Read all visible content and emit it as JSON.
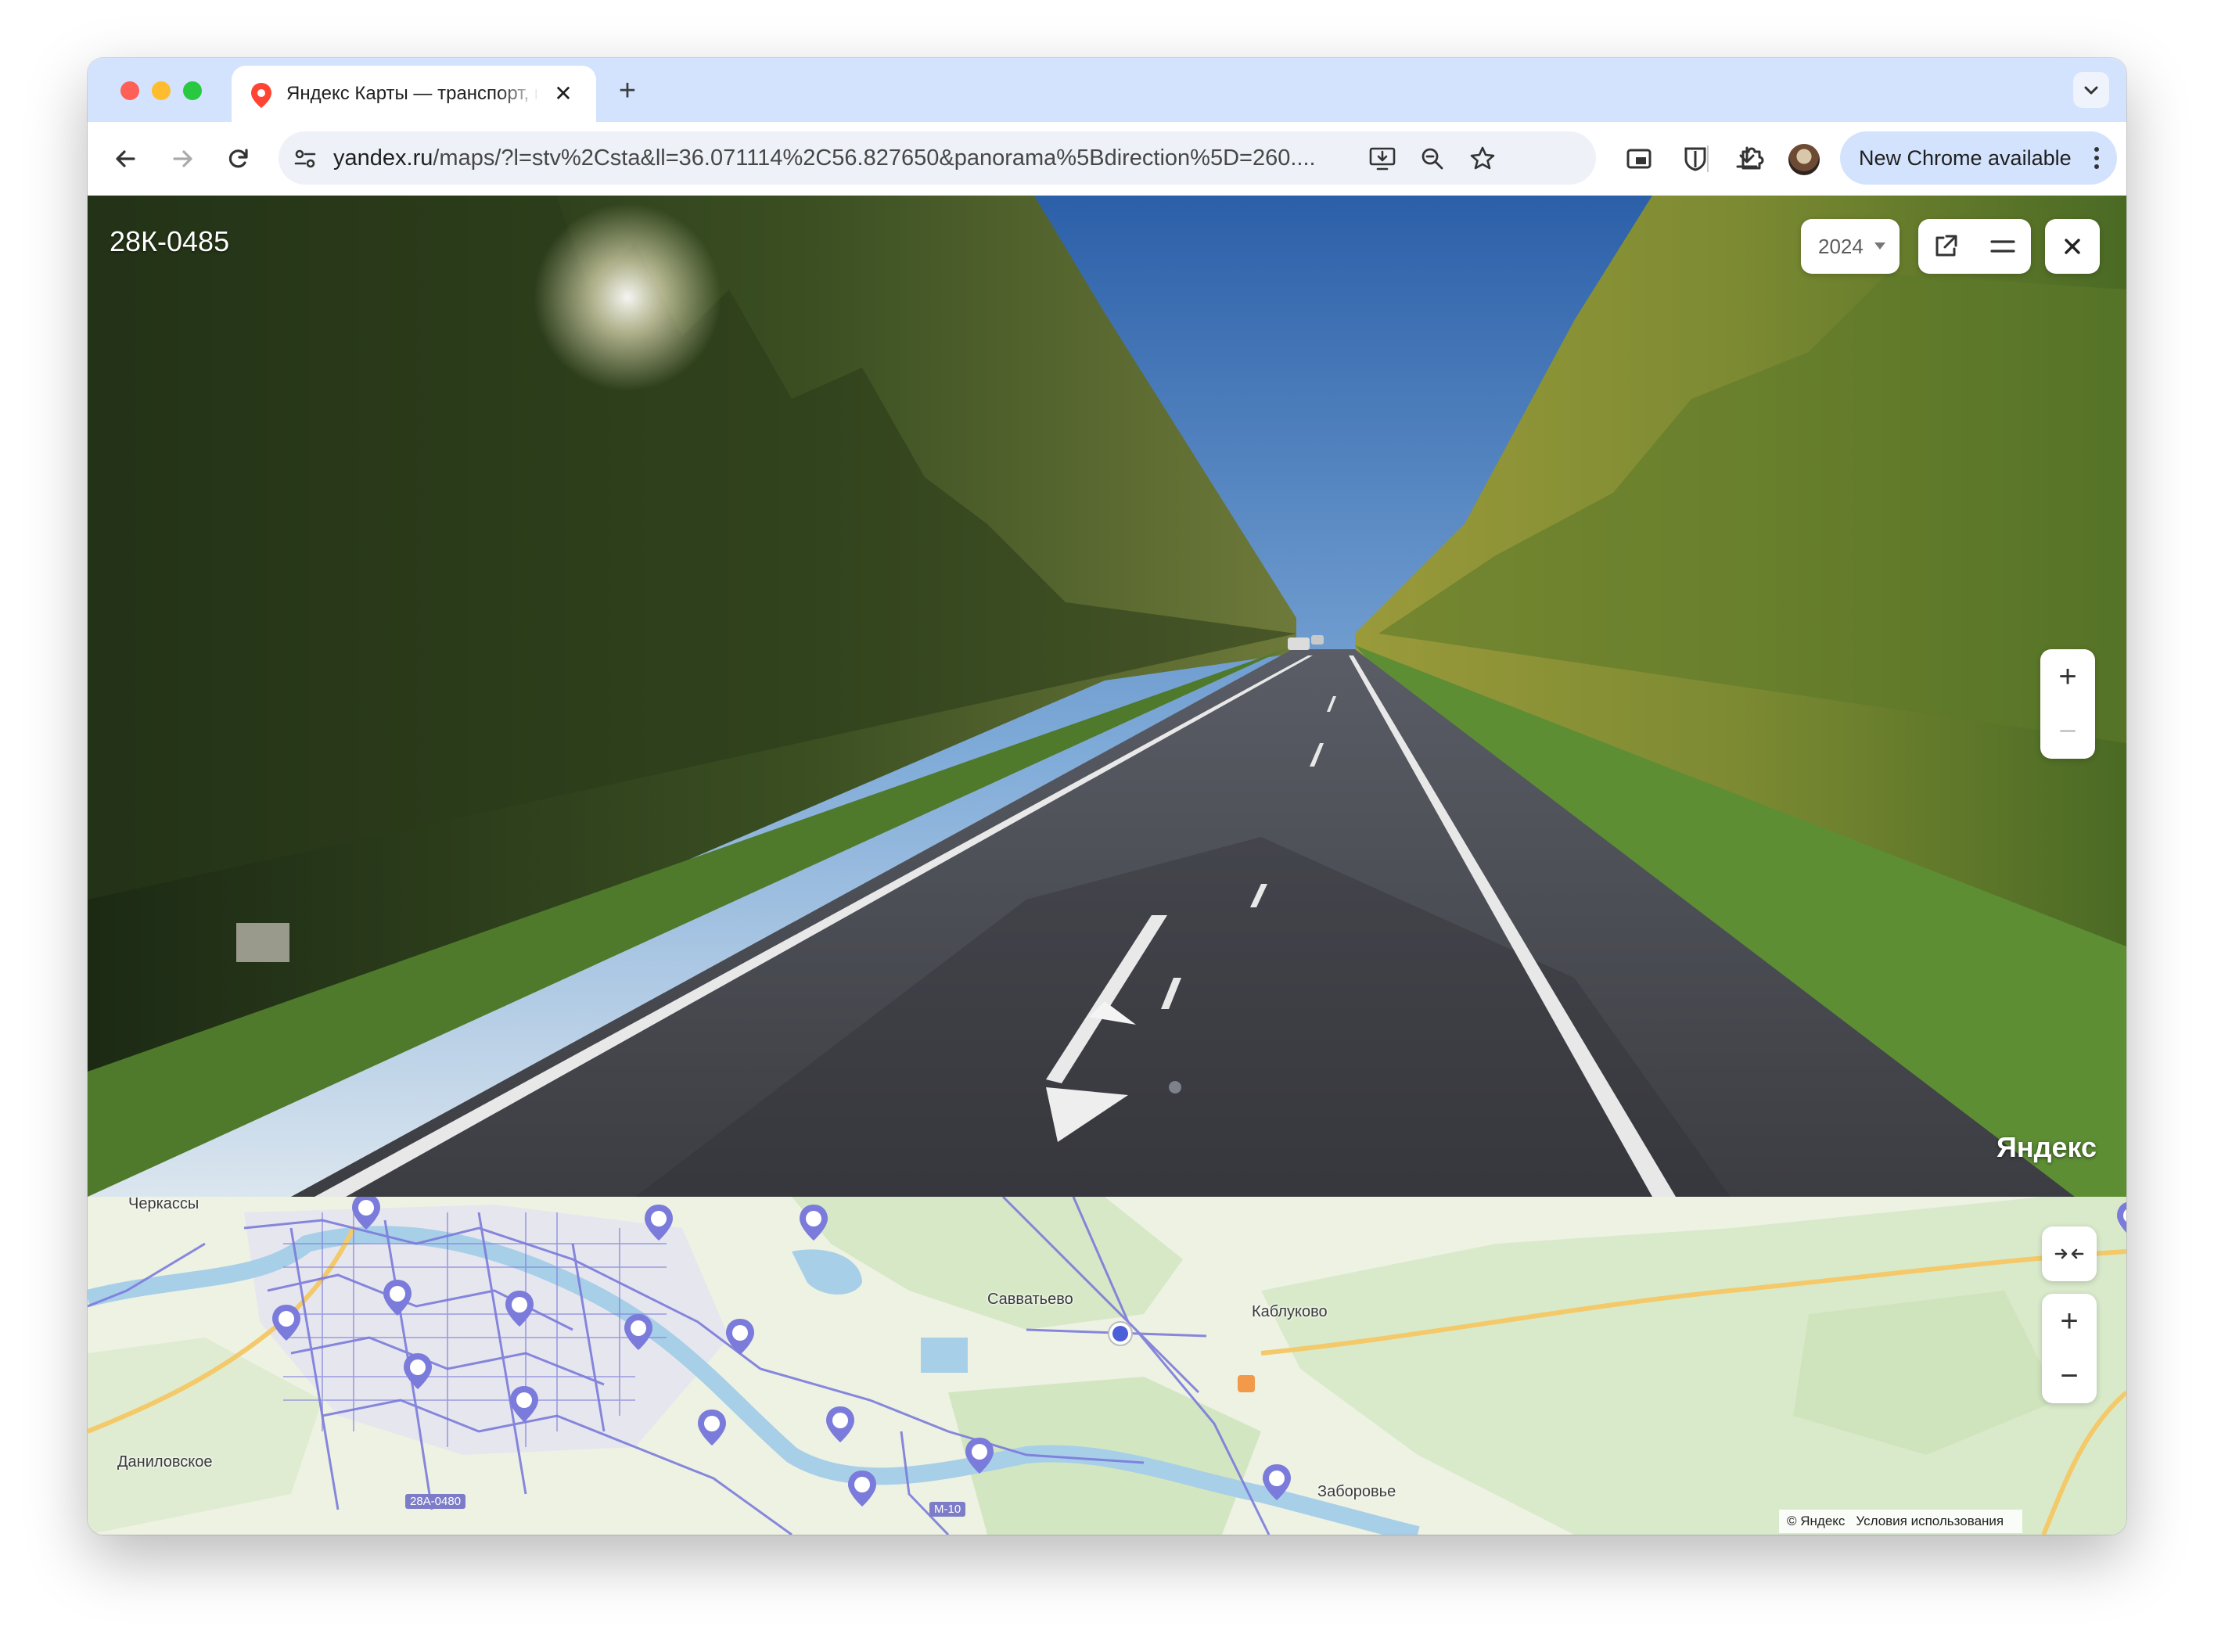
{
  "browser": {
    "tab": {
      "title": "Яндекс Карты — транспорт, навигация, поиск мест",
      "close_glyph": "✕",
      "favicon": "map-pin-icon"
    },
    "new_tab_glyph": "+",
    "address": {
      "host": "yandex.ru",
      "path": "/maps/?l=stv%2Csta&ll=36.071114%2C56.827650&panorama%5Bdirection%5D=260...."
    },
    "update_button_label": "New Chrome available",
    "accent_color": "#d3e3fd"
  },
  "panorama": {
    "road_name": "28К-0485",
    "year": "2024",
    "zoom_in": "+",
    "zoom_out": "−",
    "brand": "Яндекс"
  },
  "map": {
    "labels": {
      "cherkassy": "Черкассы",
      "savvatyevo": "Савватьево",
      "kablukovo": "Каблуково",
      "danilovskoe": "Даниловское",
      "zaborovye": "Заборовье"
    },
    "road_badges": {
      "r28a": "28А-0480",
      "m10": "М-10"
    },
    "zoom_in": "+",
    "zoom_out": "−",
    "copyright": "© Яндекс",
    "terms": "Условия использования",
    "route_color": "#7b7bdb"
  }
}
